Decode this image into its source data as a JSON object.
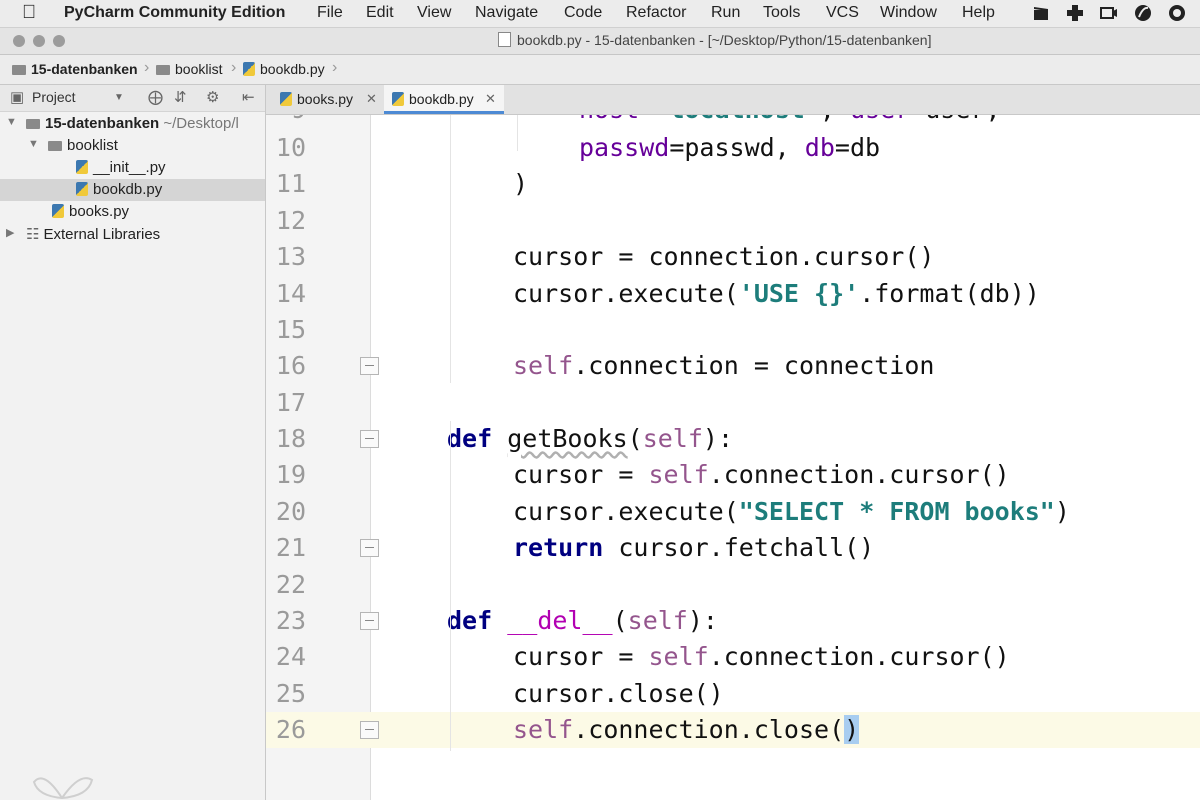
{
  "menubar": {
    "app_name": "PyCharm Community Edition",
    "menus": [
      "File",
      "Edit",
      "View",
      "Navigate",
      "Code",
      "Refactor",
      "Run",
      "Tools",
      "VCS",
      "Window",
      "Help"
    ]
  },
  "window": {
    "title": "bookdb.py - 15-datenbanken - [~/Desktop/Python/15-datenbanken]"
  },
  "breadcrumbs": {
    "items": [
      "15-datenbanken",
      "booklist",
      "bookdb.py"
    ]
  },
  "project_panel": {
    "title": "Project",
    "tree": [
      {
        "label": "15-datenbanken",
        "suffix": "~/Desktop/l"
      },
      {
        "label": "booklist"
      },
      {
        "label": "__init__.py"
      },
      {
        "label": "bookdb.py"
      },
      {
        "label": "books.py"
      },
      {
        "label": "External Libraries"
      }
    ]
  },
  "tabs": [
    {
      "label": "books.py"
    },
    {
      "label": "bookdb.py"
    }
  ],
  "editor": {
    "partial_top": "host='localhost', user=user,",
    "lines": [
      {
        "n": "10",
        "text": "passwd=passwd, db=db"
      },
      {
        "n": "11",
        "text": ")"
      },
      {
        "n": "12",
        "text": ""
      },
      {
        "n": "13",
        "text": "cursor = connection.cursor()"
      },
      {
        "n": "14",
        "text": "cursor.execute('USE {}'.format(db))"
      },
      {
        "n": "15",
        "text": ""
      },
      {
        "n": "16",
        "text": "self.connection = connection"
      },
      {
        "n": "17",
        "text": ""
      },
      {
        "n": "18",
        "text": "def getBooks(self):"
      },
      {
        "n": "19",
        "text": "cursor = self.connection.cursor()"
      },
      {
        "n": "20",
        "text": "cursor.execute(\"SELECT * FROM books\")"
      },
      {
        "n": "21",
        "text": "return cursor.fetchall()"
      },
      {
        "n": "22",
        "text": ""
      },
      {
        "n": "23",
        "text": "def __del__(self):"
      },
      {
        "n": "24",
        "text": "cursor = self.connection.cursor()"
      },
      {
        "n": "25",
        "text": "cursor.close()"
      },
      {
        "n": "26",
        "text": "self.connection.close()"
      }
    ],
    "current_line": "26"
  },
  "colors": {
    "keyword": "#000080",
    "self": "#94558d",
    "parameter": "#660099",
    "string": "#1d7d7b",
    "current_line_bg": "#fcfae6",
    "caret_highlight": "#a8cdf0",
    "tab_active_underline": "#4d8ad4"
  },
  "icons": [
    "apple-icon",
    "project-view-icon",
    "crosshair-icon",
    "collapse-icon",
    "gear-icon",
    "folder-icon",
    "python-file-icon",
    "library-icon",
    "close-icon",
    "fold-marker-icon"
  ]
}
